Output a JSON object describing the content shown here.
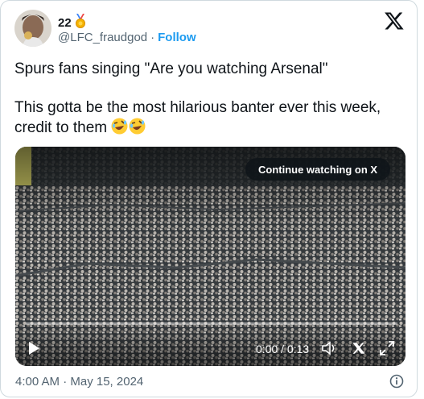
{
  "author": {
    "display_name": "22",
    "handle": "@LFC_fraudgod",
    "separator": "·",
    "follow_label": "Follow",
    "badge_icon": "medal-icon"
  },
  "tweet": {
    "line1": "Spurs fans singing \"Are you watching Arsenal\"",
    "line2": "This gotta be the most hilarious banter ever this week, credit to them",
    "emojis": [
      "rolling-on-floor-laughing",
      "rolling-on-floor-laughing"
    ]
  },
  "video": {
    "continue_label": "Continue watching on X",
    "time_display": "0:00 / 0:13",
    "icons": [
      "play-icon",
      "volume-icon",
      "x-logo-icon",
      "fullscreen-icon"
    ],
    "progress": 0
  },
  "footer": {
    "timestamp": "4:00 AM · May 15, 2024",
    "info_icon": "info-icon"
  },
  "colors": {
    "accent": "#1d9bf0",
    "muted": "#536471",
    "border": "#cfd9de"
  }
}
